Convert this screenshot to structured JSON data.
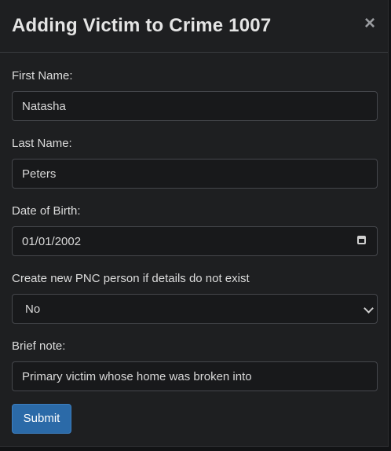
{
  "modal": {
    "title": "Adding Victim to Crime 1007",
    "close_symbol": "×"
  },
  "form": {
    "first_name": {
      "label": "First Name:",
      "value": "Natasha"
    },
    "last_name": {
      "label": "Last Name:",
      "value": "Peters"
    },
    "dob": {
      "label": "Date of Birth:",
      "value": "01/01/2002",
      "icon": "calendar-icon"
    },
    "create_pnc": {
      "label": "Create new PNC person if details do not exist",
      "selected": "No",
      "icon": "chevron-down-icon"
    },
    "note": {
      "label": "Brief note:",
      "value": "Primary victim whose home was broken into"
    },
    "submit_label": "Submit"
  },
  "colors": {
    "background": "#1e1f21",
    "field_background": "#18191b",
    "accent": "#2b6aa8"
  }
}
